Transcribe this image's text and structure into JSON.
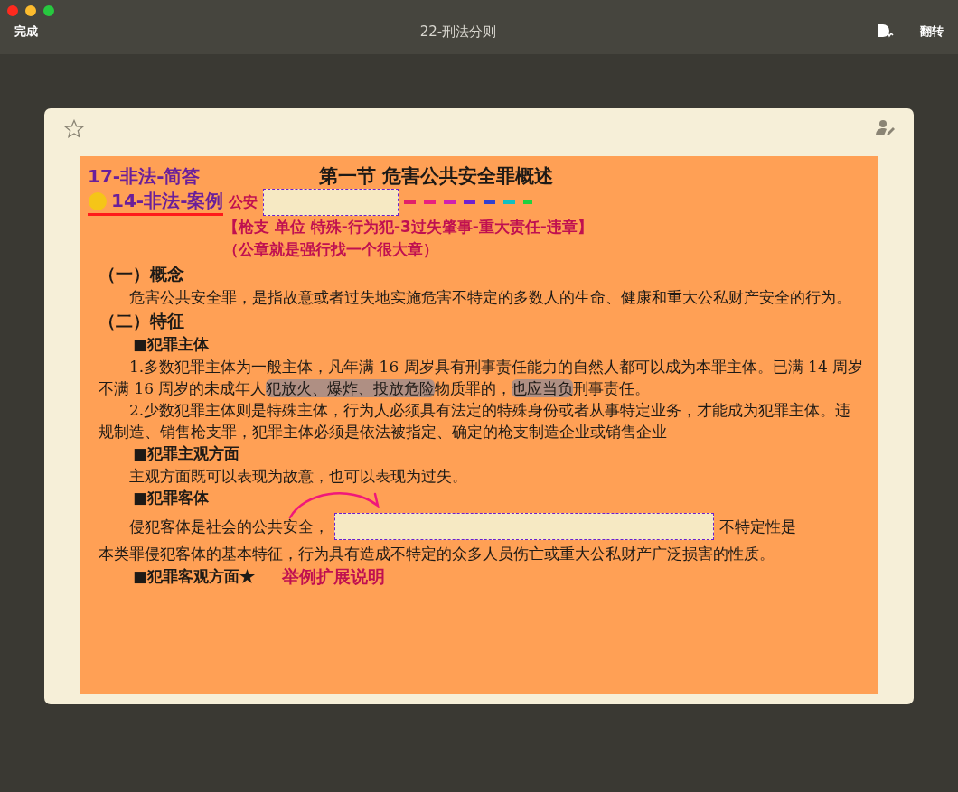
{
  "window": {
    "title": "22-刑法分则",
    "left_button": "完成",
    "right_button": "翻转"
  },
  "card": {
    "starred": false,
    "tags": [
      "17-非法-简答",
      "14-非法-案例"
    ],
    "document": {
      "title": "第一节  危害公共安全罪概述",
      "cloze_prefix": "公安",
      "notes": [
        "【枪支 单位 特殊-行为犯-3过失肇事-重大责任-违章】",
        "（公章就是强行找一个很大章）"
      ],
      "blocks": [
        {
          "kind": "heading",
          "text": "（一）概念"
        },
        {
          "kind": "paragraph",
          "segments": [
            {
              "text": "危害公共安全罪，是指故意或者过失地实施危害不特定的多数人的生命、健康和重大公私财产安全的行为。",
              "highlighted": false
            }
          ]
        },
        {
          "kind": "heading",
          "text": "（二）特征"
        },
        {
          "kind": "subheading",
          "text": "■犯罪主体"
        },
        {
          "kind": "paragraph",
          "segments": [
            {
              "text": "1.多数犯罪主体为一般主体，凡年满 16 周岁具有刑事责任能力的自然人都可以成为本罪主体。已满 14 周岁不满 16 周岁的未成年人",
              "highlighted": false
            },
            {
              "text": "犯放火、爆炸、投放危险",
              "highlighted": true
            },
            {
              "text": "物质罪的，",
              "highlighted": false
            },
            {
              "text": "也应当负",
              "highlighted": true
            },
            {
              "text": "刑事责任。",
              "highlighted": false
            }
          ]
        },
        {
          "kind": "paragraph",
          "segments": [
            {
              "text": "2.少数犯罪主体则是特殊主体，行为人必须具有法定的特殊身份或者从事特定业务，才能成为犯罪主体。违规制造、销售枪支罪，犯罪主体必须是依法被指定、确定的枪支制造企业或销售企业",
              "highlighted": false
            }
          ]
        },
        {
          "kind": "subheading",
          "text": "■犯罪主观方面"
        },
        {
          "kind": "paragraph",
          "segments": [
            {
              "text": "主观方面既可以表现为故意，也可以表现为过失。",
              "highlighted": false
            }
          ]
        },
        {
          "kind": "subheading",
          "text": "■犯罪客体",
          "arrow": true
        },
        {
          "kind": "cloze",
          "before": "侵犯客体是社会的公共安全，",
          "after": "不特定性是",
          "continuation": "本类罪侵犯客体的基本特征，行为具有造成不特定的众多人员伤亡或重大公私财产广泛损害的性质。"
        },
        {
          "kind": "subheading",
          "text": "■犯罪客观方面★",
          "note": "举例扩展说明"
        }
      ]
    }
  }
}
